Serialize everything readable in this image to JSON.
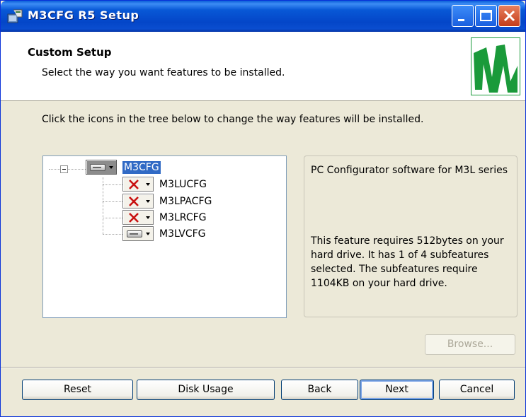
{
  "window": {
    "title": "M3CFG R5 Setup"
  },
  "header": {
    "title": "Custom Setup",
    "subtitle": "Select the way you want features to be installed."
  },
  "instruction": "Click the icons in the tree below to change the way features will be installed.",
  "tree": {
    "root": {
      "label": "M3CFG",
      "state": "installed",
      "selected": true
    },
    "children": [
      {
        "label": "M3LUCFG",
        "state": "not-available"
      },
      {
        "label": "M3LPACFG",
        "state": "not-available"
      },
      {
        "label": "M3LRCFG",
        "state": "not-available"
      },
      {
        "label": "M3LVCFG",
        "state": "installed"
      }
    ]
  },
  "description": {
    "title": "PC Configurator software for M3L series",
    "body": "This feature requires 512bytes on your hard drive. It has 1 of 4 subfeatures selected. The subfeatures require 1104KB on your hard drive."
  },
  "buttons": {
    "browse": "Browse...",
    "reset": "Reset",
    "disk_usage": "Disk Usage",
    "back": "Back",
    "next": "Next",
    "cancel": "Cancel"
  },
  "colors": {
    "titlebar": "#0a4ed0",
    "selection": "#316ac5",
    "logo_green": "#1a9a3a",
    "not_available_x": "#c81010"
  },
  "icons": {
    "window_icon": "installer-icon",
    "feature_installed": "hard-drive-icon",
    "feature_not_available": "red-x-icon",
    "logo": "m-system-logo"
  }
}
